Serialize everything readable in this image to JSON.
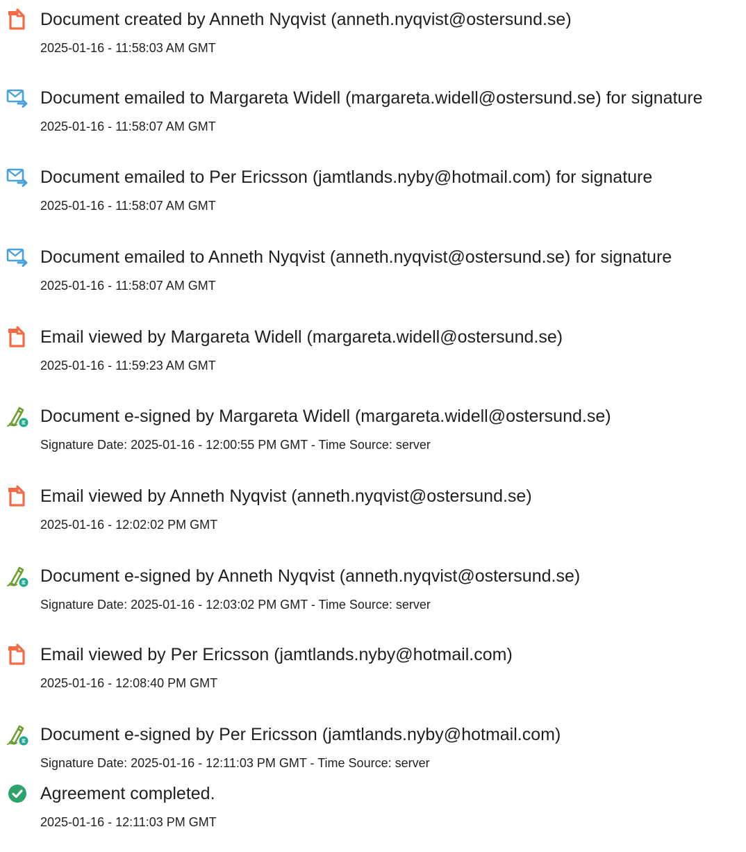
{
  "colors": {
    "document_icon": "#F26B43",
    "email_icon": "#49A1DB",
    "sign_pen": "#6F9D2E",
    "sign_badge": "#1FA88D",
    "complete_icon": "#2DA36B"
  },
  "events": [
    {
      "icon": "document-icon",
      "title": "Document created by Anneth Nyqvist (anneth.nyqvist@ostersund.se)",
      "sub": "2025-01-16 - 11:58:03 AM GMT"
    },
    {
      "icon": "email-icon",
      "title": "Document emailed to Margareta Widell (margareta.widell@ostersund.se) for signature",
      "sub": "2025-01-16 - 11:58:07 AM GMT"
    },
    {
      "icon": "email-icon",
      "title": "Document emailed to Per Ericsson (jamtlands.nyby@hotmail.com) for signature",
      "sub": "2025-01-16 - 11:58:07 AM GMT"
    },
    {
      "icon": "email-icon",
      "title": "Document emailed to Anneth Nyqvist (anneth.nyqvist@ostersund.se) for signature",
      "sub": "2025-01-16 - 11:58:07 AM GMT"
    },
    {
      "icon": "document-icon",
      "title": "Email viewed by Margareta Widell (margareta.widell@ostersund.se)",
      "sub": "2025-01-16 - 11:59:23 AM GMT"
    },
    {
      "icon": "esign-icon",
      "title": "Document e-signed by Margareta Widell (margareta.widell@ostersund.se)",
      "sub": "Signature Date: 2025-01-16 - 12:00:55 PM GMT - Time Source: server"
    },
    {
      "icon": "document-icon",
      "title": "Email viewed by Anneth Nyqvist (anneth.nyqvist@ostersund.se)",
      "sub": "2025-01-16 - 12:02:02 PM GMT"
    },
    {
      "icon": "esign-icon",
      "title": "Document e-signed by Anneth Nyqvist (anneth.nyqvist@ostersund.se)",
      "sub": "Signature Date: 2025-01-16 - 12:03:02 PM GMT - Time Source: server"
    },
    {
      "icon": "document-icon",
      "title": "Email viewed by Per Ericsson (jamtlands.nyby@hotmail.com)",
      "sub": "2025-01-16 - 12:08:40 PM GMT"
    },
    {
      "icon": "esign-icon",
      "title": "Document e-signed by Per Ericsson (jamtlands.nyby@hotmail.com)",
      "sub": "Signature Date: 2025-01-16 - 12:11:03 PM GMT - Time Source: server"
    },
    {
      "icon": "check-circle-icon",
      "title": "Agreement completed.",
      "sub": "2025-01-16 - 12:11:03 PM GMT"
    }
  ]
}
